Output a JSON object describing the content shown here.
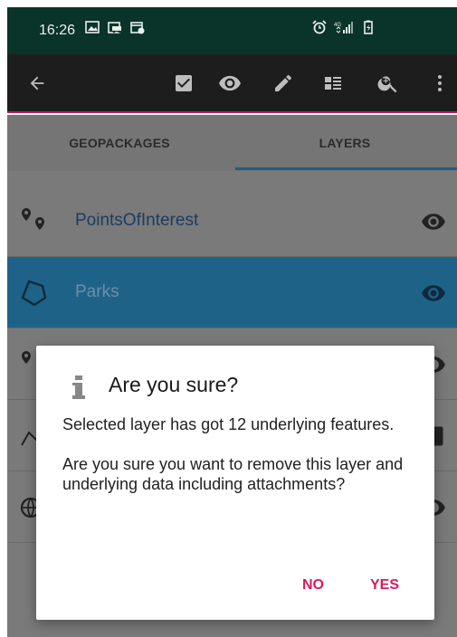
{
  "status_bar": {
    "time": "16:26",
    "left_icons": [
      "image-icon",
      "car-icon",
      "calendar-icon"
    ],
    "right_icons": [
      "alarm-icon",
      "4g-signal-icon",
      "battery-icon"
    ],
    "network": "4G"
  },
  "toolbar": {
    "back_icon": "arrow-left-icon",
    "actions": [
      "check-box-icon",
      "eye-icon",
      "pencil-icon",
      "view-list-icon",
      "zoom-in-icon",
      "more-vert-icon"
    ]
  },
  "tabs": {
    "items": [
      {
        "label": "GEOPACKAGES",
        "active": false
      },
      {
        "label": "LAYERS",
        "active": true
      }
    ]
  },
  "layers": [
    {
      "label": "PointsOfInterest",
      "icon": "multipoint-icon",
      "visible": true,
      "selected": false
    },
    {
      "label": "Parks",
      "icon": "polygon-icon",
      "visible": true,
      "selected": true
    }
  ],
  "dialog": {
    "icon": "info-icon",
    "title": "Are you sure?",
    "message_1": "Selected layer has got 12 underlying features.",
    "message_2": "Are you sure you want to remove this layer and underlying data including attachments?",
    "no_label": "NO",
    "yes_label": "YES"
  },
  "colors": {
    "accent": "#d81b60",
    "selected_row": "#1f6287",
    "status_bar": "#0a3429",
    "toolbar": "#1d1d1d"
  }
}
